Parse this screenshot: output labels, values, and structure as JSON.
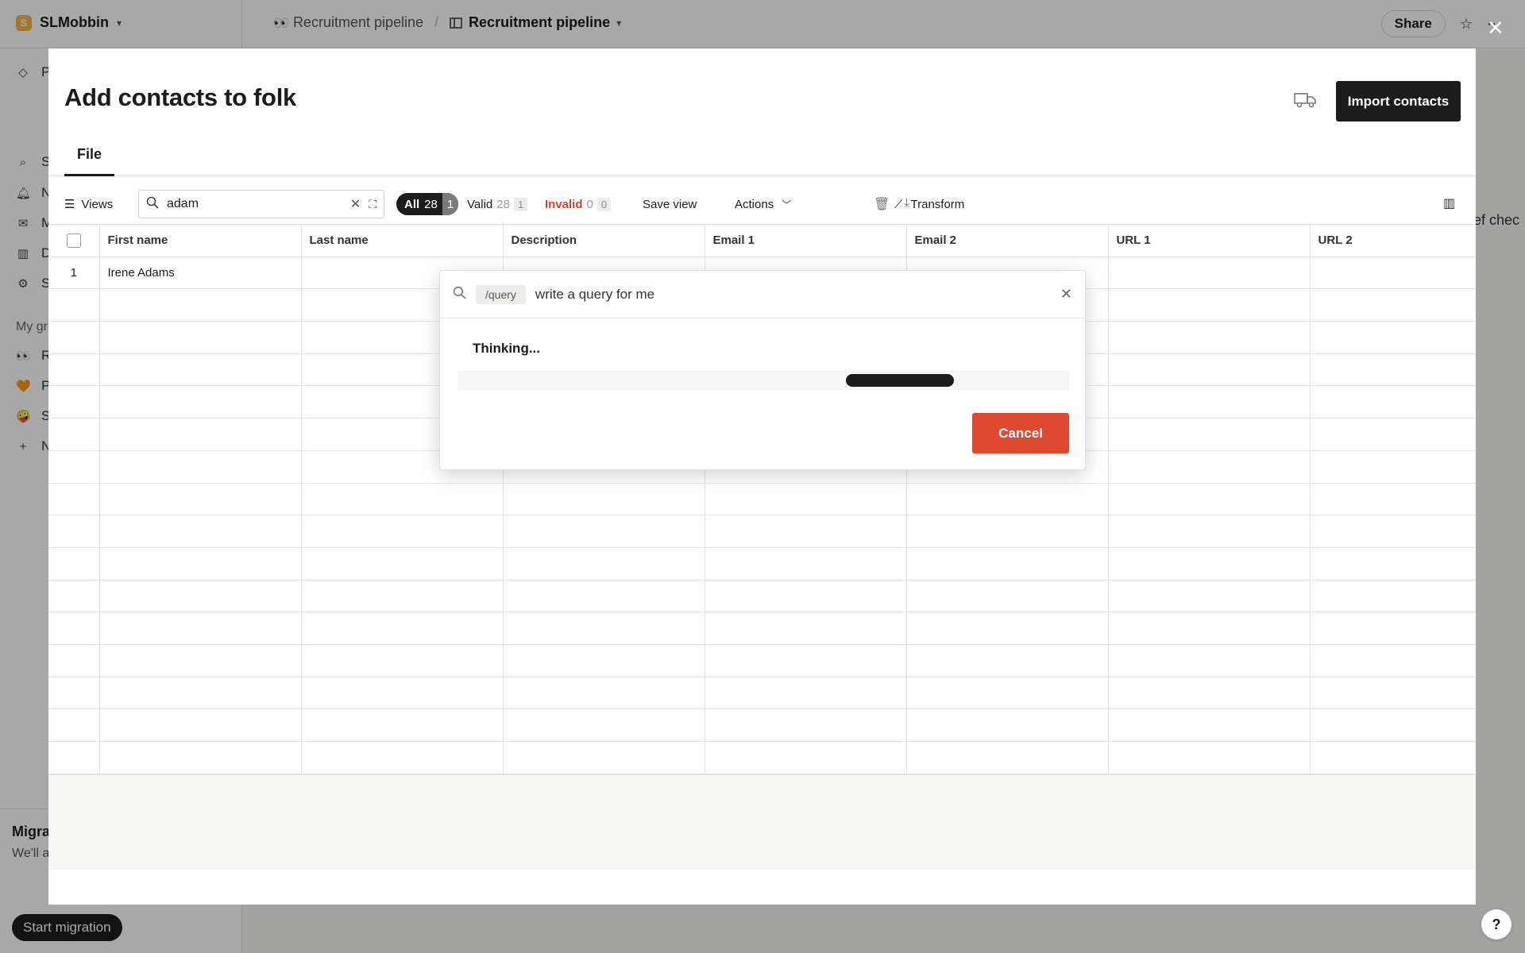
{
  "workspace": {
    "name": "SLMobbin",
    "logo_letter": "S"
  },
  "breadcrumb": {
    "parent": "Recruitment pipeline",
    "parent_emoji": "👀",
    "current": "Recruitment pipeline",
    "separator": "/"
  },
  "topbar": {
    "share_label": "Share"
  },
  "sidebar": {
    "items": [
      {
        "label": "Pr",
        "icon": "diamond-icon"
      },
      {
        "label": "S",
        "icon": "search-icon"
      },
      {
        "label": "N",
        "icon": "bell-icon"
      },
      {
        "label": "M",
        "icon": "mail-icon"
      },
      {
        "label": "D",
        "icon": "chart-icon"
      },
      {
        "label": "S",
        "icon": "gear-icon"
      }
    ],
    "groups_heading": "My gr",
    "groups": [
      {
        "emoji": "👀",
        "label": "R"
      },
      {
        "emoji": "🧡",
        "label": "P"
      },
      {
        "emoji": "🤪",
        "label": "S"
      },
      {
        "emoji": "+",
        "label": "N"
      }
    ],
    "migration": {
      "title": "Migra",
      "text": "We'll a conta migra",
      "button_label": "Start migration"
    }
  },
  "background_right_text": "ef chec",
  "modal": {
    "title": "Add contacts to folk",
    "import_label": "Import contacts",
    "tabs": [
      {
        "label": "File"
      }
    ],
    "toolbar": {
      "views_label": "Views",
      "search_value": "adam",
      "filters": {
        "all": {
          "label": "All",
          "count": "28",
          "selected": "1"
        },
        "valid": {
          "label": "Valid",
          "count": "28",
          "selected": "1"
        },
        "invalid": {
          "label": "Invalid",
          "count": "0",
          "selected": "0"
        }
      },
      "save_view_label": "Save view",
      "actions_label": "Actions",
      "transform_label": "Transform"
    },
    "table": {
      "columns": [
        "First name",
        "Last name",
        "Description",
        "Email 1",
        "Email 2",
        "URL 1",
        "URL 2"
      ],
      "rows": [
        {
          "num": "1",
          "first_name": "Irene Adams",
          "last_name": "",
          "description": "",
          "email1": "",
          "email2": "",
          "url1": "",
          "url2": ""
        }
      ]
    }
  },
  "palette": {
    "chip": "/query",
    "input_value": "write a query for me",
    "status": "Thinking...",
    "cancel_label": "Cancel",
    "progress": {
      "start": 0.635,
      "end": 0.812
    }
  },
  "colors": {
    "accent_red": "#dd4a30",
    "primary_dark": "#1c1c1c",
    "invalid_red": "#d9452b"
  }
}
